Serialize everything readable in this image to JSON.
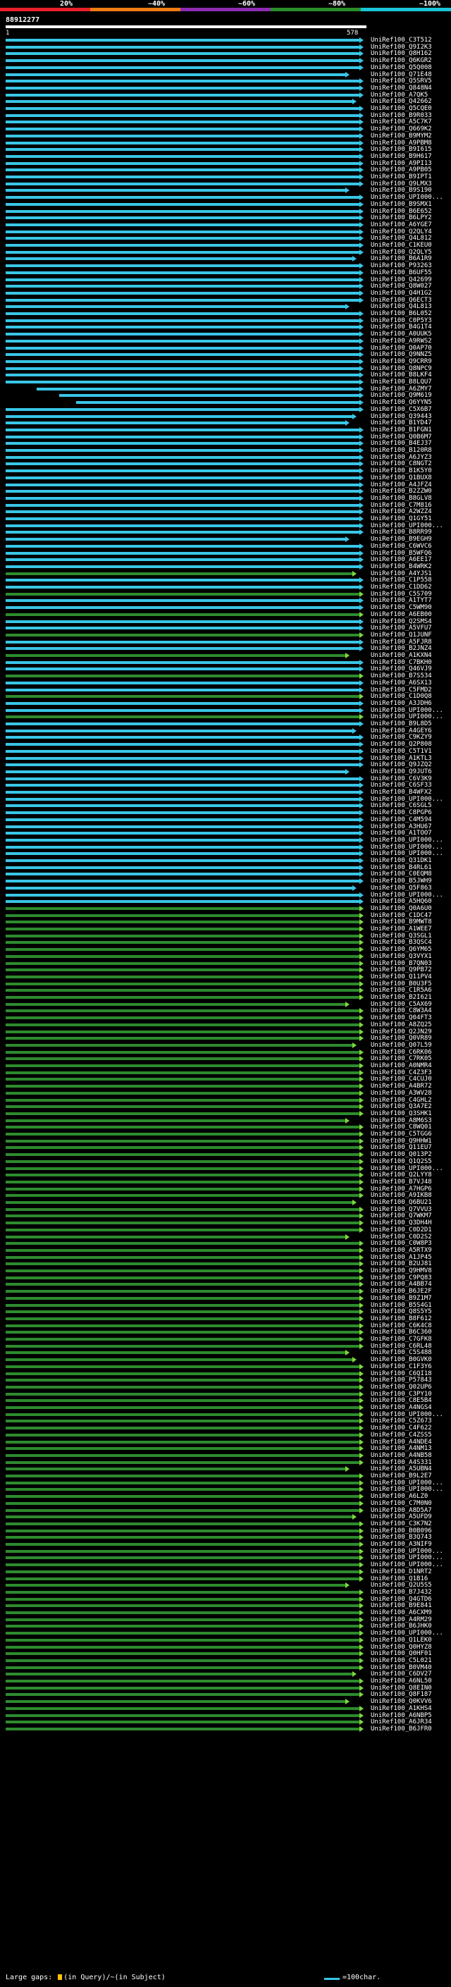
{
  "scale": {
    "labels": [
      "20%",
      "~40%",
      "~60%",
      "~80%",
      "~100%"
    ],
    "colors": [
      "#e8202a",
      "#f07c13",
      "#8e2bb2",
      "#2a8f2a",
      "#18c6d8"
    ]
  },
  "query": {
    "id": "88912277",
    "start": "1",
    "end": "578"
  },
  "colors": {
    "high_identity": "#39c6e6",
    "mid_identity": "#2e8b2e",
    "arrow": "#7ed93c",
    "query_bar": "#ffffff"
  },
  "hits": [
    "UniRef100_C3T512",
    "UniRef100_Q9I2K3",
    "UniRef100_Q8H162",
    "UniRef100_Q6KGR2",
    "UniRef100_Q5Q008",
    "UniRef100_Q71E48",
    "UniRef100_Q5SRV5",
    "UniRef100_Q848N4",
    "UniRef100_A7QK5",
    "UniRef100_Q42662",
    "UniRef100_Q5CQE0",
    "UniRef100_B9R033",
    "UniRef100_A5C7K7",
    "UniRef100_Q669K2",
    "UniRef100_B9MYM2",
    "UniRef100_A9PBM8",
    "UniRef100_B9I615",
    "UniRef100_B9H617",
    "UniRef100_A9PI13",
    "UniRef100_A9PB05",
    "UniRef100_B9IPT1",
    "UniRef100_Q9LMX3",
    "UniRef100_B9S190",
    "UniRef100_UPI000...",
    "UniRef100_B9SMX1",
    "UniRef100_B6E652",
    "UniRef100_B6LPY2",
    "UniRef100_A6YGE7",
    "UniRef100_Q2QLY4",
    "UniRef100_Q4L812",
    "UniRef100_C1KEU0",
    "UniRef100_Q2QLY5",
    "UniRef100_B6A1R9",
    "UniRef100_P93263",
    "UniRef100_B6UF55",
    "UniRef100_Q42699",
    "UniRef100_Q8W027",
    "UniRef100_Q4H1G2",
    "UniRef100_Q6ECT3",
    "UniRef100_Q4L813",
    "UniRef100_B6L052",
    "UniRef100_C0P5Y3",
    "UniRef100_B4G1T4",
    "UniRef100_A0UUK5",
    "UniRef100_A9RWS2",
    "UniRef100_Q0AP70",
    "UniRef100_Q9NNZ5",
    "UniRef100_Q9CRR9",
    "UniRef100_Q8NPC9",
    "UniRef100_B8LKF4",
    "UniRef100_B8LQU7",
    "UniRef100_A6ZMY7",
    "UniRef100_Q9M619",
    "UniRef100_Q6YYN5",
    "UniRef100_C5X6B7",
    "UniRef100_Q39443",
    "UniRef100_B1YD47",
    "UniRef100_B1FGN1",
    "UniRef100_Q0B6M7",
    "UniRef100_B4EJ37",
    "UniRef100_B120R8",
    "UniRef100_A6JYZ3",
    "UniRef100_C8NGT2",
    "UniRef100_B1K5Y0",
    "UniRef100_Q1BUX8",
    "UniRef100_A4JFZ4",
    "UniRef100_B2ZZW0",
    "UniRef100_B8GLV8",
    "UniRef100_C7M816",
    "UniRef100_A2WZZ4",
    "UniRef100_Q1GY51",
    "UniRef100_UPI000...",
    "UniRef100_B8RR99",
    "UniRef100_B9EGH9",
    "UniRef100_C6WVC6",
    "UniRef100_B5WFQ6",
    "UniRef100_A6EE17",
    "UniRef100_B4WRK2",
    "UniRef100_A4YJS1",
    "UniRef100_C1P558",
    "UniRef100_C1DD62",
    "UniRef100_C5S709",
    "UniRef100_A1TYT7",
    "UniRef100_C5WM90",
    "UniRef100_A6EB00",
    "UniRef100_Q2SMS4",
    "UniRef100_A5VFU7",
    "UniRef100_Q1JUNF",
    "UniRef100_A5FJR8",
    "UniRef100_B2JNZ4",
    "UniRef100_A1KXN4",
    "UniRef100_C7BKH0",
    "UniRef100_Q46VJ9",
    "UniRef100_B7S534",
    "UniRef100_A6SX13",
    "UniRef100_C5FMD2",
    "UniRef100_C1D0Q8",
    "UniRef100_A3JDH6",
    "UniRef100_UPI000...",
    "UniRef100_UPI000...",
    "UniRef100_B9L8D5",
    "UniRef100_A4GEY6",
    "UniRef100_C9KZY9",
    "UniRef100_Q2P808",
    "UniRef100_C5T1V1",
    "UniRef100_A1KTL3",
    "UniRef100_Q9JZQ2",
    "UniRef100_Q9JUT6",
    "UniRef100_C6V3K9",
    "UniRef100_C6SF33",
    "UniRef100_B4WFX2",
    "UniRef100_UPI000...",
    "UniRef100_C6SGL5",
    "UniRef100_C8PGP6",
    "UniRef100_C4M594",
    "UniRef100_A3HU67",
    "UniRef100_A1TOO7",
    "UniRef100_UPI000...",
    "UniRef100_UPI000...",
    "UniRef100_UPI000...",
    "UniRef100_Q31DK1",
    "UniRef100_B4RL61",
    "UniRef100_C0EQM8",
    "UniRef100_B5JWH9",
    "UniRef100_Q5F863",
    "UniRef100_UPI000...",
    "UniRef100_A5HQ60",
    "UniRef100_Q0A6U0",
    "UniRef100_C1DC47",
    "UniRef100_B9MWT8",
    "UniRef100_A1WEE7",
    "UniRef100_Q3SGL1",
    "UniRef100_B3QSC4",
    "UniRef100_Q6YM65",
    "UniRef100_Q3VYX1",
    "UniRef100_B7QN03",
    "UniRef100_Q9PB72",
    "UniRef100_Q11PV4",
    "UniRef100_B0U3F5",
    "UniRef100_C1R5A6",
    "UniRef100_B2I621",
    "UniRef100_C5AX69",
    "UniRef100_C8W3A4",
    "UniRef100_Q04FT3",
    "UniRef100_A8ZQ25",
    "UniRef100_Q2JN29",
    "UniRef100_Q0VR89",
    "UniRef100_Q07L59",
    "UniRef100_C6RK06",
    "UniRef100_C7RK05",
    "UniRef100_A0NMR4",
    "UniRef100_C4Z3F3",
    "UniRef100_C4CUJ0",
    "UniRef100_A4BR72",
    "UniRef100_A3WV28",
    "UniRef100_C4GHL2",
    "UniRef100_Q3A7E2",
    "UniRef100_Q3SHK1",
    "UniRef100_A8M6S3",
    "UniRef100_C8WQ01",
    "UniRef100_C5TGG6",
    "UniRef100_Q9HHW1",
    "UniRef100_Q11EU7",
    "UniRef100_Q013P2",
    "UniRef100_Q1Q2S5",
    "UniRef100_UPI000...",
    "UniRef100_Q2LYY8",
    "UniRef100_B7VJ48",
    "UniRef100_A7HGP6",
    "UniRef100_A9IKB8",
    "UniRef100_Q6BU21",
    "UniRef100_Q7VVU3",
    "UniRef100_Q7WKM7",
    "UniRef100_Q3DH4H",
    "UniRef100_C0D2D1",
    "UniRef100_C0D2S2",
    "UniRef100_C0W8P3",
    "UniRef100_A5RTX9",
    "UniRef100_A1JP45",
    "UniRef100_B2UJ81",
    "UniRef100_Q9HMV8",
    "UniRef100_C9PQ83",
    "UniRef100_A4BB74",
    "UniRef100_B6JE2F",
    "UniRef100_B9Z1M7",
    "UniRef100_B5S4G1",
    "UniRef100_Q8S5Y5",
    "UniRef100_B8F612",
    "UniRef100_C6K4C8",
    "UniRef100_B6C360",
    "UniRef100_C7GFK8",
    "UniRef100_C6RL48",
    "UniRef100_C5S488",
    "UniRef100_B0GVK0",
    "UniRef100_C1F3Y6",
    "UniRef100_C6QI18",
    "UniRef100_P57843",
    "UniRef100_Q02UP6",
    "UniRef100_C3PY10",
    "UniRef100_C8E5B4",
    "UniRef100_A4NGS4",
    "UniRef100_UPI000...",
    "UniRef100_C5Z673",
    "UniRef100_C4F622",
    "UniRef100_C4ZSS5",
    "UniRef100_A4NDE4",
    "UniRef100_A4NM13",
    "UniRef100_A4NB58",
    "UniRef100_A4S331",
    "UniRef100_A5UBN4",
    "UniRef100_B9L2E7",
    "UniRef100_UPI000...",
    "UniRef100_UPI000...",
    "UniRef100_A6LZ0",
    "UniRef100_C7M0N0",
    "UniRef100_A8D5A7",
    "UniRef100_A5UFD9",
    "UniRef100_C3K7N2",
    "UniRef100_B0B096",
    "UniRef100_B3Q743",
    "UniRef100_A3NIF9",
    "UniRef100_UPI000...",
    "UniRef100_UPI000...",
    "UniRef100_UPI000...",
    "UniRef100_D1NRT2",
    "UniRef100_Q1B16",
    "UniRef100_Q2U5S5",
    "UniRef100_B7J432",
    "UniRef100_Q4GTD6",
    "UniRef100_B9E841",
    "UniRef100_A6CXM9",
    "UniRef100_A4RM29",
    "UniRef100_B6JHK0",
    "UniRef100_UPI000...",
    "UniRef100_Q1LEK0",
    "UniRef100_Q0HYZ8",
    "UniRef100_Q0HF01",
    "UniRef100_C5L021",
    "UniRef100_B0VM40",
    "UniRef100_C6DV27",
    "UniRef100_A6NL50",
    "UniRef100_Q8EIN0",
    "UniRef100_Q8F187",
    "UniRef100_Q0KVV6",
    "UniRef100_A1KHS4",
    "UniRef100_A6NBP5",
    "UniRef100_A6JR34",
    "UniRef100_B6JFR0"
  ],
  "footer": {
    "prefix": "Large gaps:",
    "in_query": "(in Query)",
    "sep": "/~",
    "in_subject": "(in Subject)",
    "legend": "=100char."
  }
}
